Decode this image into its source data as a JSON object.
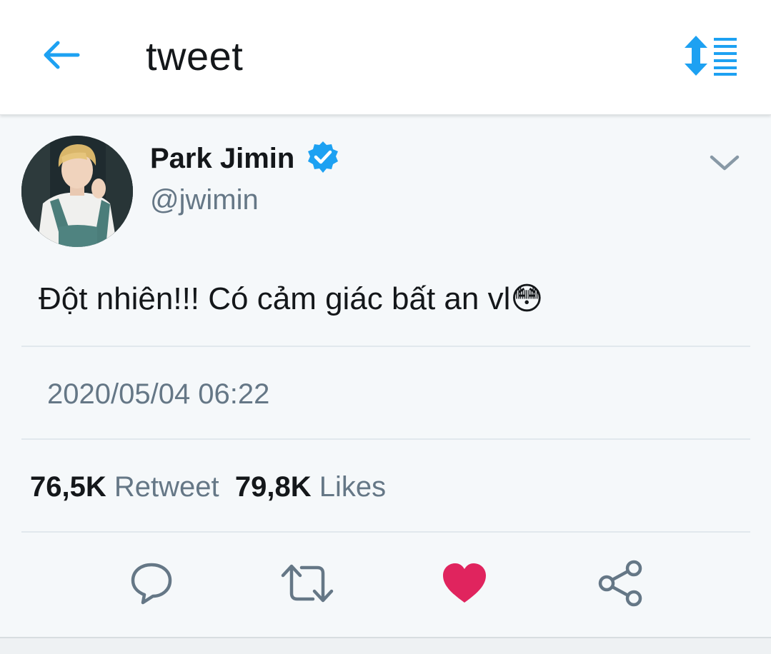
{
  "header": {
    "title": "tweet",
    "back_icon": "arrow-left-icon",
    "sort_icon": "sort-arrows-list-icon",
    "accent_color": "#1da1f2"
  },
  "tweet": {
    "author": {
      "display_name": "Park Jimin",
      "handle": "@jwimin",
      "verified": true,
      "avatar_icon": "user-avatar-photo"
    },
    "text": "Đột nhiên!!! Có cảm giác bất an vl",
    "emoji": "😳",
    "timestamp": "2020/05/04 06:22",
    "stats": {
      "retweets_count": "76,5K",
      "retweets_label": "Retweet",
      "likes_count": "79,8K",
      "likes_label": "Likes"
    },
    "actions": {
      "reply_icon": "reply-bubble-icon",
      "retweet_icon": "retweet-icon",
      "like_icon": "heart-icon",
      "share_icon": "share-icon",
      "like_color": "#e0245e",
      "icon_color": "#657786"
    }
  }
}
